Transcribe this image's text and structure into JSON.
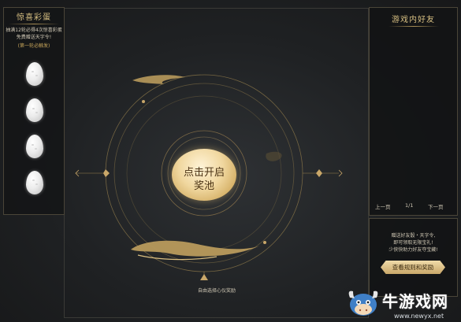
{
  "left_panel": {
    "title": "惊喜彩蛋",
    "desc_line1": "抽满12轮必得4次惊喜彩蛋",
    "desc_line2": "免费赠送天字令!",
    "hint": "(第一轮必触发)",
    "eggs": [
      "egg",
      "egg",
      "egg",
      "egg"
    ]
  },
  "right_panel": {
    "title": "游戏内好友",
    "prev_label": "上一页",
    "page_indicator": "1/1",
    "next_label": "下一页"
  },
  "invite": {
    "line1": "赠送好友骰・天字令,",
    "line2": "即可领取无限宝礼!",
    "line3": "少侠快助力好友夺宝藏!",
    "button_label": "查看规则和奖励"
  },
  "center": {
    "button_line1": "点击开启",
    "button_line2": "奖池",
    "caption": "自由选择心仪奖励"
  },
  "watermark": {
    "title": "牛游戏网",
    "url": "www.newyx.net"
  },
  "colors": {
    "gold": "#c9a769",
    "background": "#1f2123"
  }
}
